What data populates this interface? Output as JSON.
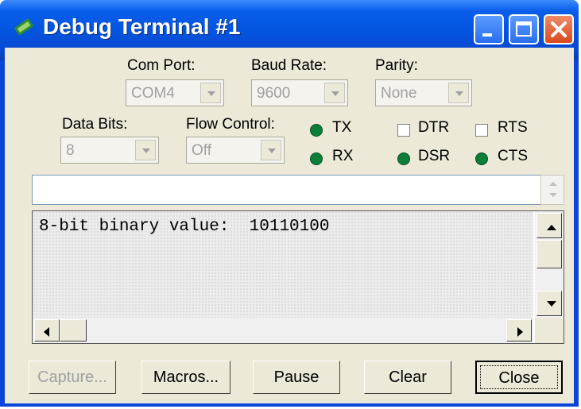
{
  "window": {
    "title": "Debug Terminal #1"
  },
  "com_port": {
    "label": "Com Port:",
    "value": "COM4"
  },
  "baud_rate": {
    "label": "Baud Rate:",
    "value": "9600"
  },
  "parity": {
    "label": "Parity:",
    "value": "None"
  },
  "data_bits": {
    "label": "Data Bits:",
    "value": "8"
  },
  "flow_control": {
    "label": "Flow Control:",
    "value": "Off"
  },
  "indicators": {
    "tx": "TX",
    "rx": "RX",
    "dsr": "DSR",
    "cts": "CTS",
    "led_color": "#0b7f3a"
  },
  "checkboxes": {
    "dtr": "DTR",
    "rts": "RTS"
  },
  "transmit": {
    "value": ""
  },
  "output": {
    "text": "8-bit binary value:  10110100"
  },
  "buttons": {
    "capture": "Capture...",
    "macros": "Macros...",
    "pause": "Pause",
    "clear": "Clear",
    "close": "Close"
  },
  "icons": [
    "app-icon",
    "minimize-icon",
    "maximize-icon",
    "close-icon"
  ]
}
